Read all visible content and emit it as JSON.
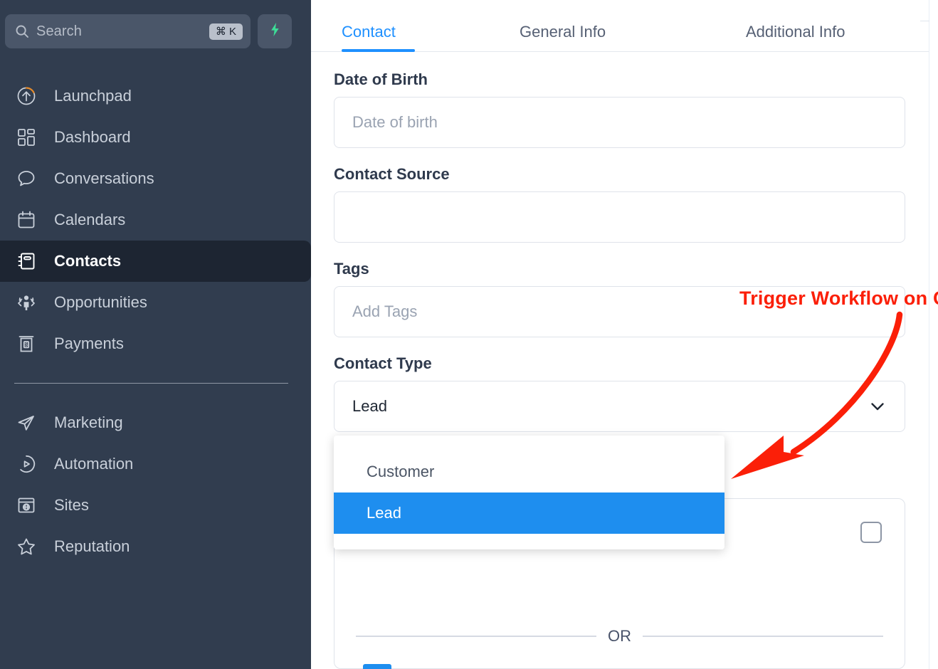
{
  "sidebar": {
    "search": {
      "placeholder": "Search",
      "shortcut": "⌘ K",
      "icon": "search-icon"
    },
    "quick_action": {
      "icon": "lightning-bolt-icon"
    },
    "items": [
      {
        "label": "Launchpad",
        "icon": "rocket-launch-icon",
        "active": false
      },
      {
        "label": "Dashboard",
        "icon": "dashboard-grid-icon",
        "active": false
      },
      {
        "label": "Conversations",
        "icon": "chat-bubble-icon",
        "active": false
      },
      {
        "label": "Calendars",
        "icon": "calendar-icon",
        "active": false
      },
      {
        "label": "Contacts",
        "icon": "contact-book-icon",
        "active": true
      },
      {
        "label": "Opportunities",
        "icon": "person-arrows-icon",
        "active": false
      },
      {
        "label": "Payments",
        "icon": "receipt-dollar-icon",
        "active": false
      }
    ],
    "items_secondary": [
      {
        "label": "Marketing",
        "icon": "paper-plane-icon",
        "active": false
      },
      {
        "label": "Automation",
        "icon": "play-circle-icon",
        "active": false
      },
      {
        "label": "Sites",
        "icon": "browser-globe-icon",
        "active": false
      },
      {
        "label": "Reputation",
        "icon": "star-icon",
        "active": false
      }
    ]
  },
  "main": {
    "tabs": [
      {
        "label": "Contact",
        "active": true
      },
      {
        "label": "General Info",
        "active": false
      },
      {
        "label": "Additional Info",
        "active": false
      }
    ],
    "fields": {
      "date_of_birth": {
        "label": "Date of Birth",
        "value": "",
        "placeholder": "Date of birth"
      },
      "contact_source": {
        "label": "Contact Source",
        "value": "",
        "placeholder": ""
      },
      "tags": {
        "label": "Tags",
        "value": "",
        "placeholder": "Add Tags"
      },
      "contact_type": {
        "label": "Contact Type",
        "value": "Lead",
        "chevron": "chevron-down-icon",
        "options": [
          {
            "label": "Customer",
            "selected": false
          },
          {
            "label": "Lead",
            "selected": true
          }
        ]
      }
    },
    "or_card": {
      "divider_text": "OR",
      "checkbox_checked": false
    }
  },
  "annotation": {
    "text": "Trigger Workflow on Change",
    "color": "#fb1f08"
  },
  "colors": {
    "sidebar_bg": "#313d4f",
    "sidebar_active_bg": "#1d2532",
    "accent_blue": "#1e8eef",
    "tab_active": "#1e90ff",
    "bolt_green": "#3ddc97",
    "annotation_red": "#fb1f08"
  }
}
